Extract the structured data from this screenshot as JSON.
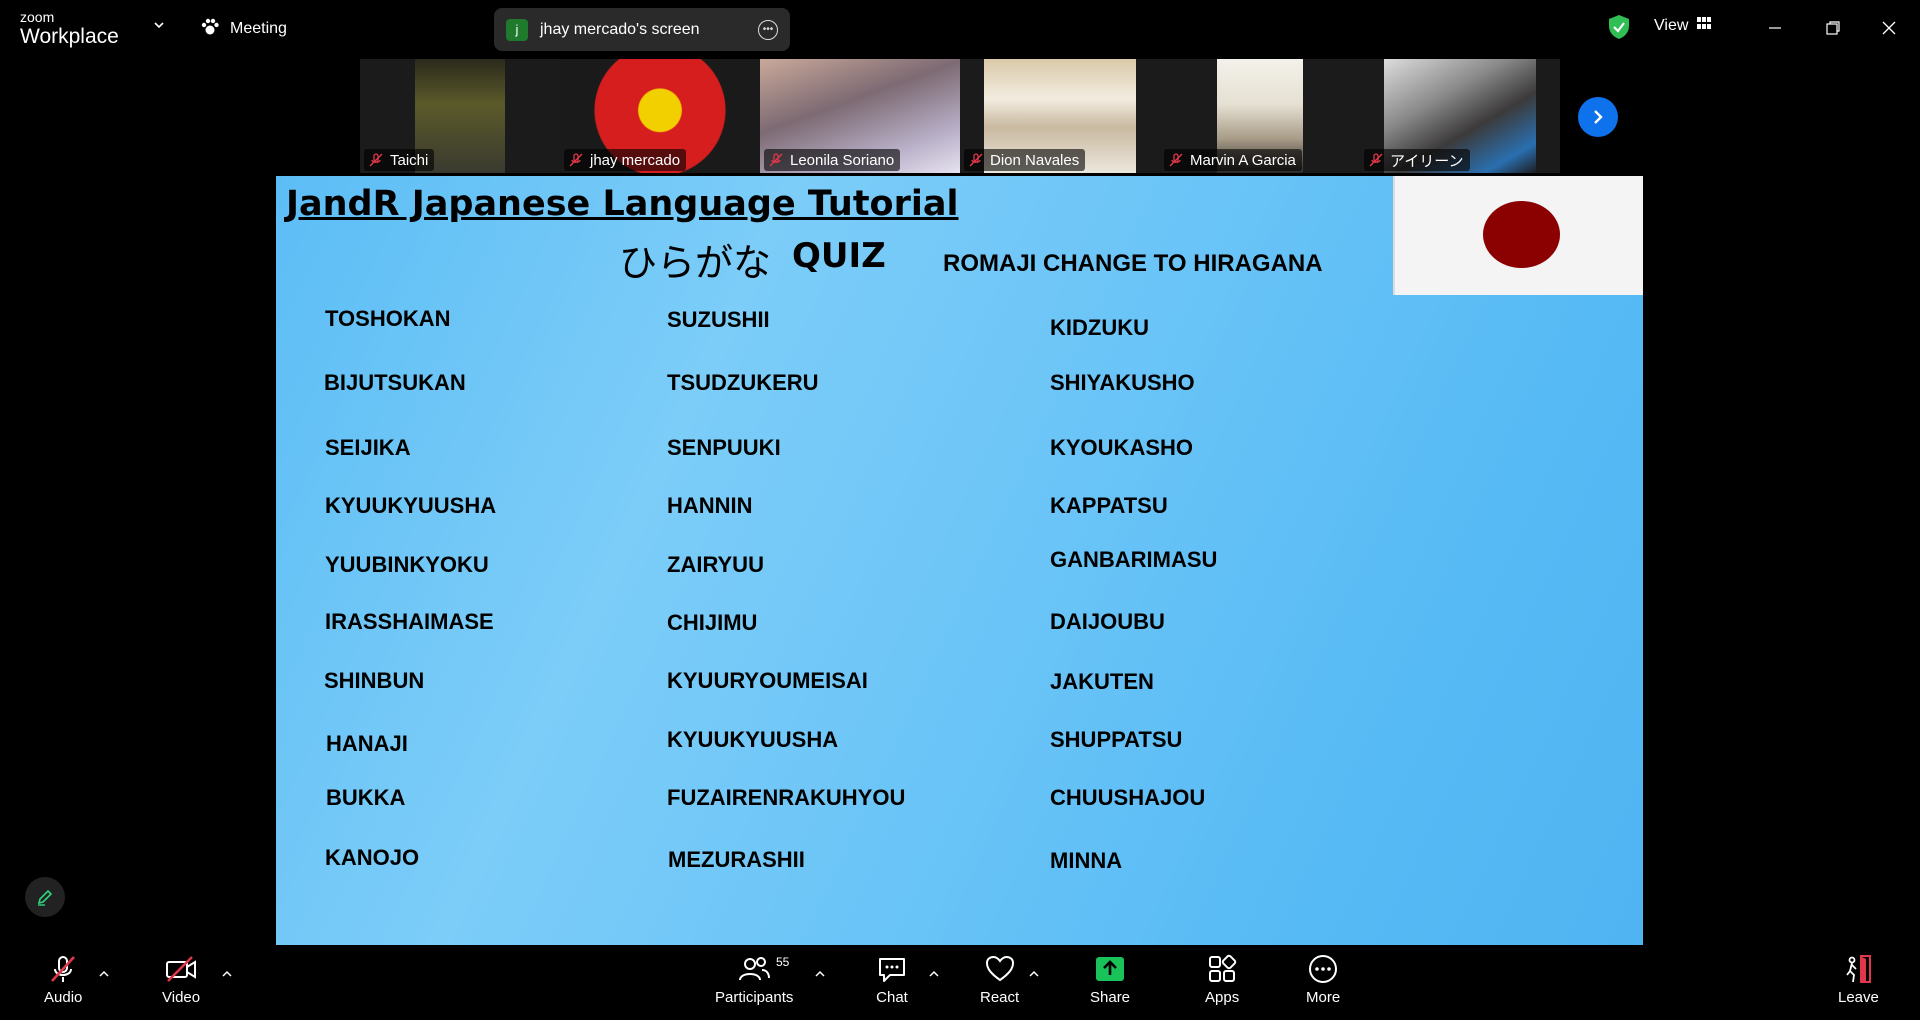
{
  "app": {
    "logo_top": "zoom",
    "logo_bottom": "Workplace"
  },
  "titlebar": {
    "meeting_label": "Meeting",
    "screen_owner_initial": "j",
    "screen_label": "jhay mercado's screen",
    "view_label": "View"
  },
  "participants_strip": [
    {
      "name": "Taichi"
    },
    {
      "name": "jhay mercado",
      "active": true
    },
    {
      "name": "Leonila Soriano"
    },
    {
      "name": "Dion Navales"
    },
    {
      "name": "Marvin A Garcia"
    },
    {
      "name": "アイリーン"
    }
  ],
  "slide": {
    "title": "JandR Japanese Language Tutorial",
    "subtitle_jp": "ひらがな",
    "subtitle_quiz": "QUIZ",
    "instruction": "ROMAJI CHANGE TO HIRAGANA",
    "col1": [
      "TOSHOKAN",
      "BIJUTSUKAN",
      "SEIJIKA",
      "KYUUKYUUSHA",
      "YUUBINKYOKU",
      "IRASSHAIMASE",
      "SHINBUN",
      "HANAJI",
      "BUKKA",
      "KANOJO"
    ],
    "col2": [
      "SUZUSHII",
      "TSUDZUKERU",
      "SENPUUKI",
      "HANNIN",
      "ZAIRYUU",
      "CHIJIMU",
      "KYUURYOUMEISAI",
      "KYUUKYUUSHA",
      "FUZAIRENRAKUHYOU",
      "MEZURASHII"
    ],
    "col3": [
      "KIDZUKU",
      "SHIYAKUSHO",
      "KYOUKASHO",
      "KAPPATSU",
      "GANBARIMASU",
      "DAIJOUBU",
      "JAKUTEN",
      "SHUPPATSU",
      "CHUUSHAJOU",
      "MINNA"
    ]
  },
  "toolbar": {
    "audio": "Audio",
    "video": "Video",
    "participants": "Participants",
    "participants_count": "55",
    "chat": "Chat",
    "react": "React",
    "share": "Share",
    "apps": "Apps",
    "more": "More",
    "leave": "Leave"
  },
  "colors": {
    "accent_green": "#2fd47c",
    "share_green": "#19c35a",
    "blue": "#0e72ed",
    "leave_red": "#e0384a"
  }
}
